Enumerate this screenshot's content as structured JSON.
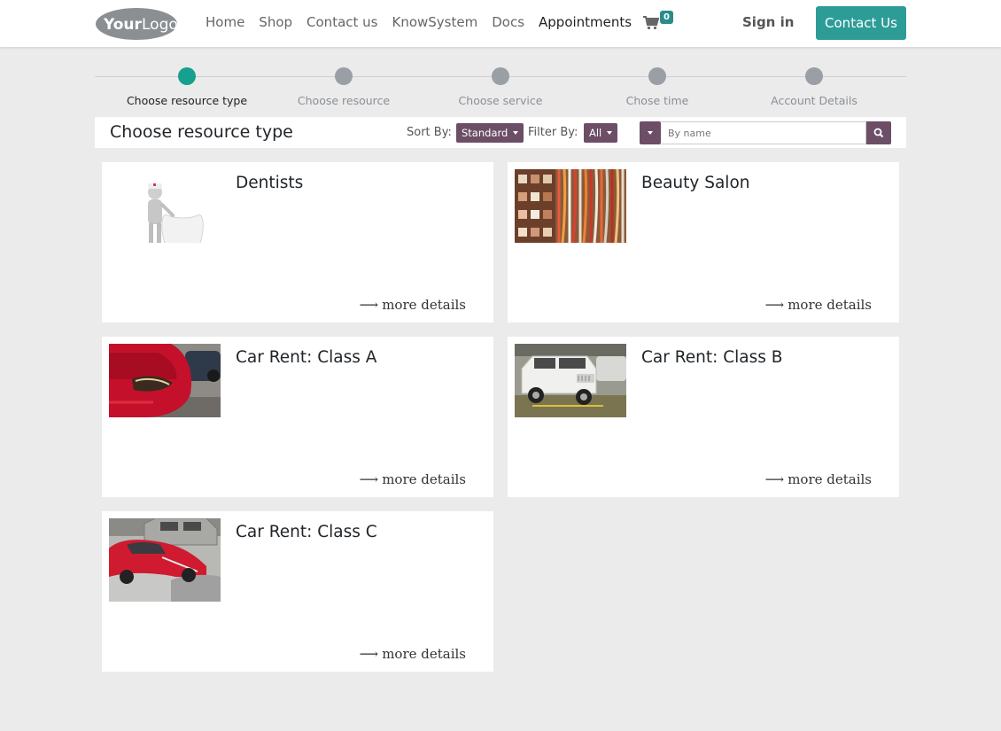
{
  "header": {
    "logo_text": "YourLogo",
    "nav": [
      {
        "label": "Home"
      },
      {
        "label": "Shop"
      },
      {
        "label": "Contact us"
      },
      {
        "label": "KnowSystem"
      },
      {
        "label": "Docs"
      },
      {
        "label": "Appointments",
        "active": true
      }
    ],
    "cart_count": "0",
    "sign_in": "Sign in",
    "contact_button": "Contact Us"
  },
  "steps": [
    {
      "label": "Choose resource type",
      "active": true
    },
    {
      "label": "Choose resource",
      "active": false
    },
    {
      "label": "Choose service",
      "active": false
    },
    {
      "label": "Chose time",
      "active": false
    },
    {
      "label": "Account Details",
      "active": false
    }
  ],
  "toolbar": {
    "title": "Choose resource type",
    "sort_label": "Sort By:",
    "sort_value": "Standard",
    "filter_label": "Filter By:",
    "filter_value": "All",
    "search_placeholder": "By name"
  },
  "cards": [
    {
      "title": "Dentists",
      "more": "more details",
      "image": "dentist-figure-with-tooth"
    },
    {
      "title": "Beauty Salon",
      "more": "more details",
      "image": "salon-colorful-textiles"
    },
    {
      "title": "Car Rent: Class A",
      "more": "more details",
      "image": "red-car-headlight"
    },
    {
      "title": "Car Rent: Class B",
      "more": "more details",
      "image": "white-jeep-in-garage"
    },
    {
      "title": "Car Rent: Class C",
      "more": "more details",
      "image": "parking-lot-cars"
    }
  ],
  "colors": {
    "accent": "#2d9c97",
    "active_step": "#16a08f",
    "inactive_step": "#9a9fa6",
    "dropdown": "#6c4e66",
    "background": "#ebebeb"
  }
}
